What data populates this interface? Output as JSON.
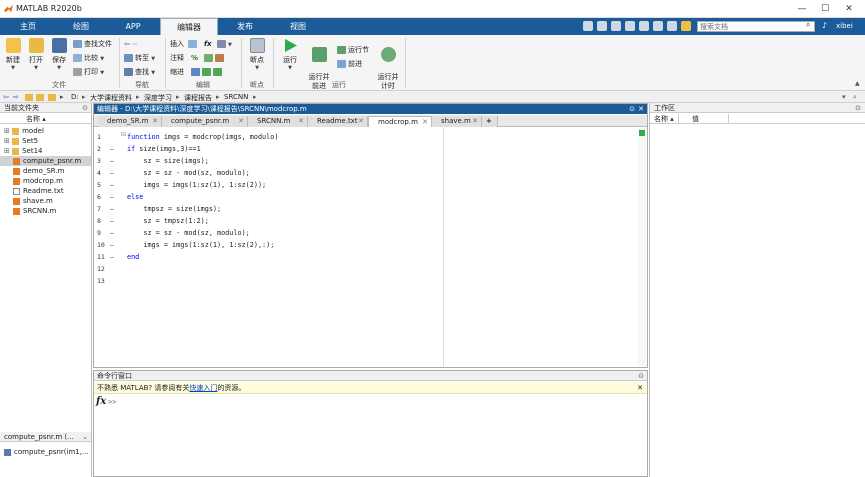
{
  "titlebar": {
    "title": "MATLAB R2020b",
    "minimize": "—",
    "maximize": "☐",
    "close": "✕"
  },
  "tabs": [
    {
      "label": "主页"
    },
    {
      "label": "绘图"
    },
    {
      "label": "APP"
    },
    {
      "label": "编辑器"
    },
    {
      "label": "发布"
    },
    {
      "label": "视图"
    }
  ],
  "search": {
    "placeholder": "搜索文档",
    "user": "xibei"
  },
  "ribbon": {
    "file": {
      "new": "新建",
      "open": "打开",
      "save": "保存",
      "find_files": "查找文件",
      "compare": "比较",
      "print": "打印",
      "group": "文件"
    },
    "navigate": {
      "goto": "转至",
      "find": "查找",
      "group": "导航"
    },
    "edit": {
      "insert": "插入",
      "fx": "fx",
      "comment": "注释",
      "percent": "%",
      "indent": "缩进",
      "group": "编辑"
    },
    "breakpoints": {
      "breakpoint": "断点",
      "group": "断点"
    },
    "run": {
      "run": "运行",
      "run_advance": "运行并\n前进",
      "run_section": "运行节",
      "advance": "前进",
      "run_time": "运行并\n计时",
      "group": "运行"
    }
  },
  "address": {
    "drive": "D:",
    "crumbs": [
      "大学课程资料",
      "深度学习",
      "课程报告",
      "SRCNN"
    ]
  },
  "left_pane": {
    "title": "当前文件夹",
    "column": "名称 ▴",
    "files": [
      {
        "name": "model",
        "type": "folder"
      },
      {
        "name": "Set5",
        "type": "folder"
      },
      {
        "name": "Set14",
        "type": "folder"
      },
      {
        "name": "compute_psnr.m",
        "type": "m"
      },
      {
        "name": "demo_SR.m",
        "type": "m"
      },
      {
        "name": "modcrop.m",
        "type": "m"
      },
      {
        "name": "Readme.txt",
        "type": "txt"
      },
      {
        "name": "shave.m",
        "type": "m"
      },
      {
        "name": "SRCNN.m",
        "type": "m"
      }
    ],
    "detail_title": "compute_psnr.m (...",
    "detail_value": "compute_psnr(im1,..."
  },
  "editor": {
    "header": "编辑器 - D:\\大学课程资料\\深度学习\\课程报告\\SRCNN\\modcrop.m",
    "tabs": [
      "demo_SR.m",
      "compute_psnr.m",
      "SRCNN.m",
      "Readme.txt",
      "modcrop.m",
      "shave.m"
    ],
    "active_tab": "modcrop.m",
    "lines": [
      "function imgs = modcrop(imgs, modulo)",
      "if size(imgs,3)==1",
      "    sz = size(imgs);",
      "    sz = sz - mod(sz, modulo);",
      "    imgs = imgs(1:sz(1), 1:sz(2));",
      "else",
      "    tmpsz = size(imgs);",
      "    sz = tmpsz(1:2);",
      "    sz = sz - mod(sz, modulo);",
      "    imgs = imgs(1:sz(1), 1:sz(2),:);",
      "end",
      "",
      ""
    ],
    "line_numbers": [
      "1",
      "2",
      "3",
      "4",
      "5",
      "6",
      "7",
      "8",
      "9",
      "10",
      "11",
      "12",
      "13"
    ],
    "dash": "–"
  },
  "command": {
    "title": "命令行窗口",
    "tip_prefix": "不熟悉 MATLAB? 请参阅有关",
    "tip_link": "快速入门",
    "tip_suffix": "的资源。",
    "prompt": ">>",
    "fx": "fx"
  },
  "workspace": {
    "title": "工作区",
    "col_name": "名称 ▴",
    "col_value": "值"
  }
}
